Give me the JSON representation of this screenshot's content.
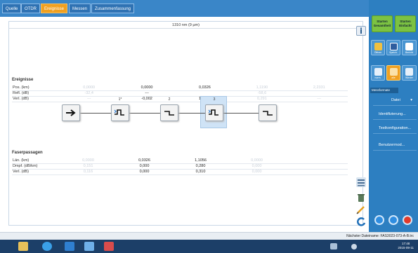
{
  "tabs": [
    {
      "label": "Quelle",
      "active": false
    },
    {
      "label": "OTDR",
      "active": false
    },
    {
      "label": "Ereignisse",
      "active": true
    },
    {
      "label": "Messen",
      "active": false
    },
    {
      "label": "Zusammenfassung",
      "active": false
    }
  ],
  "header": {
    "wavelength": "1310 nm (9 µm)"
  },
  "events_section": {
    "title": "Ereignisse",
    "rows": [
      {
        "label": "Pos. (km)",
        "cells": [
          "0,0000",
          "0,0000",
          "0,0326",
          "1,1190",
          "2,2331"
        ]
      },
      {
        "label": "Refl. (dB)",
        "cells": [
          "-32,4",
          "---",
          "",
          "-58,6",
          ""
        ]
      },
      {
        "label": "Verl. (dB)",
        "cells": [
          "---",
          "-0,002",
          "17,845",
          "0,291",
          "---"
        ]
      }
    ]
  },
  "chain": {
    "node_numbers": [
      "",
      "1*",
      "2",
      "3",
      ""
    ]
  },
  "fiber_section": {
    "title": "Faserpassagen",
    "rows": [
      {
        "label": "Län. (km)",
        "cells": [
          "0,0000",
          "0,0326",
          "1,1056",
          "0,0000"
        ]
      },
      {
        "label": "Dmpf. (dB/km)",
        "cells": [
          "0,151",
          "0,000",
          "0,280",
          "0,000"
        ]
      },
      {
        "label": "Verl. (dB)",
        "cells": [
          "0,116",
          "0,000",
          "0,310",
          "0,000"
        ]
      }
    ]
  },
  "right_panel": {
    "start_buttons": [
      "Starten Gesamtheit",
      "Starten Einfacht"
    ],
    "file_buttons": [
      "Öffnen",
      "Speich.",
      "Bericht"
    ],
    "view_buttons": [
      "norm.",
      "alle",
      "Wieder"
    ],
    "section_label": "Messformate",
    "menu": [
      "Datei",
      "Identifizierung...",
      "Testkonfiguration...",
      "Benutzermod..."
    ]
  },
  "status": {
    "next_file": "Nächster Dateiname: FAS3023-073-A-B.trc"
  },
  "taskbar": {
    "clock_time": "17:48",
    "clock_date": "2015-09-11"
  },
  "colors": {
    "topbar": "#3a86c8",
    "tab_active": "#f0a020",
    "right_panel": "#2d7fc1",
    "start_green": "#7cc242",
    "taskbar": "#1c3f68"
  }
}
